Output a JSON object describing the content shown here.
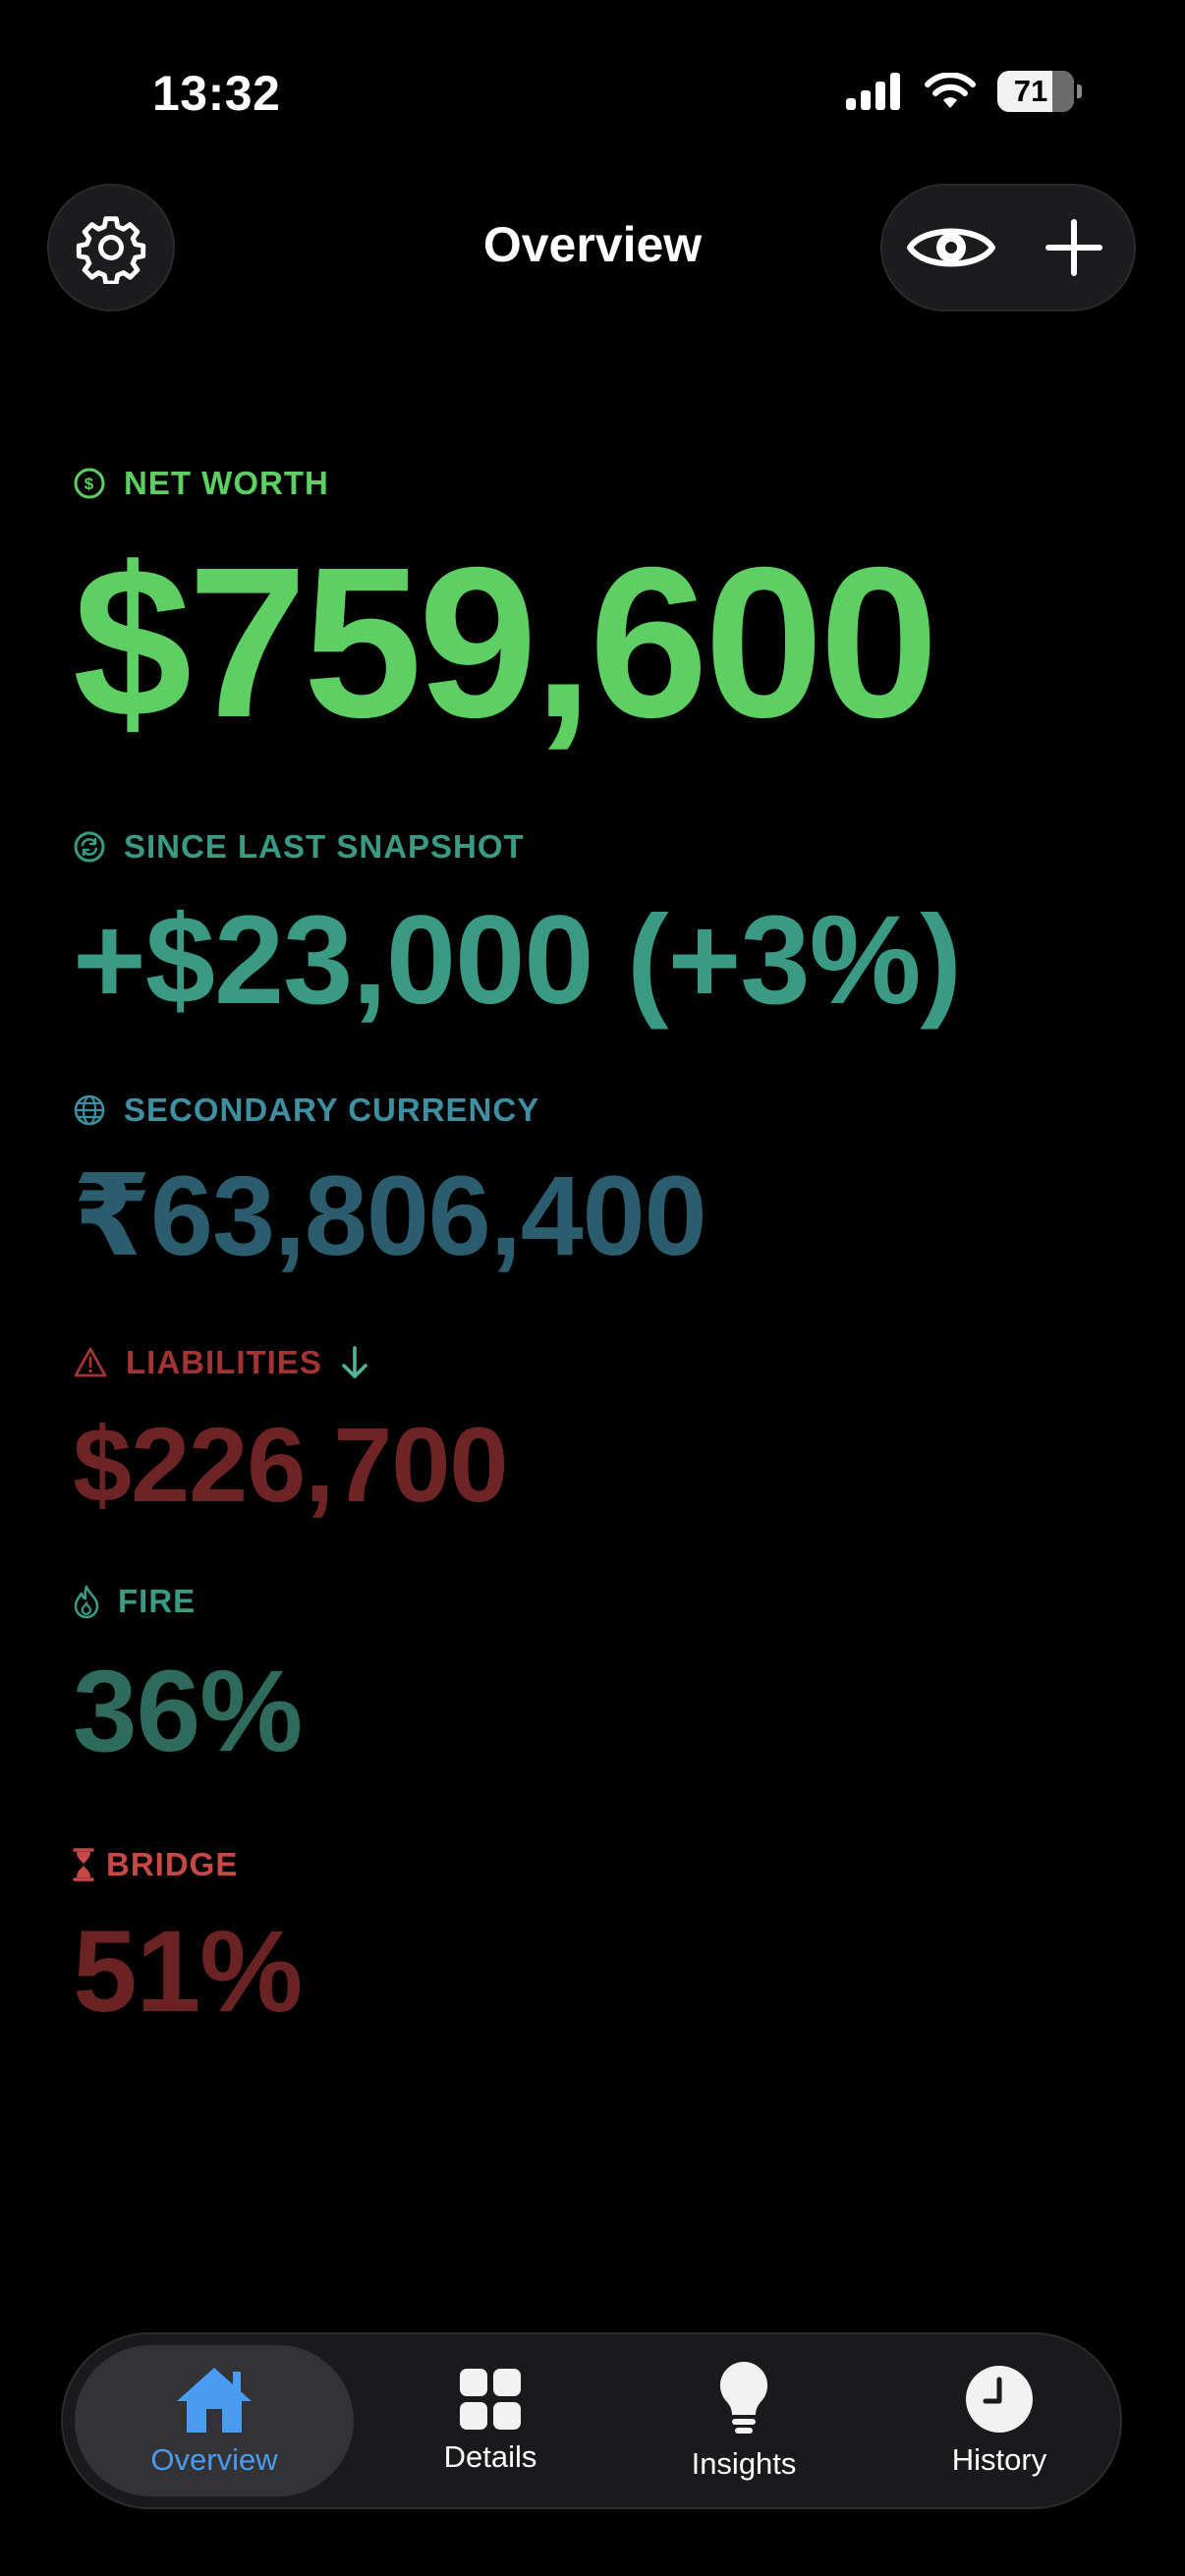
{
  "status_bar": {
    "time": "13:32",
    "battery": "71",
    "icons": [
      "cellular-signal-icon",
      "wifi-icon",
      "battery-icon"
    ]
  },
  "header": {
    "title": "Overview",
    "left_icon": "gear-icon",
    "right_icons": [
      "eye-icon",
      "plus-icon"
    ]
  },
  "metrics": {
    "net_worth": {
      "label": "NET WORTH",
      "value": "$759,600",
      "icon": "dollar-circle-icon",
      "color": "#5ecf63"
    },
    "since_last": {
      "label": "SINCE LAST SNAPSHOT",
      "value": "+$23,000 (+3%)",
      "icon": "refresh-circle-icon",
      "color": "#3a9a84"
    },
    "secondary_currency": {
      "label": "SECONDARY CURRENCY",
      "value": "₹63,806,400",
      "icon": "globe-icon",
      "color": "#2c5d6e"
    },
    "liabilities": {
      "label": "LIABILITIES",
      "value": "$226,700",
      "icon": "warning-triangle-icon",
      "trend_icon": "arrow-down-icon",
      "color": "#6e2424"
    },
    "fire": {
      "label": "FIRE",
      "value": "36%",
      "icon": "flame-icon",
      "color": "#2e6b5c"
    },
    "bridge": {
      "label": "BRIDGE",
      "value": "51%",
      "icon": "hourglass-icon",
      "color": "#6b2222"
    }
  },
  "tabbar": {
    "tabs": [
      {
        "label": "Overview",
        "icon": "house-icon",
        "active": true
      },
      {
        "label": "Details",
        "icon": "grid-icon",
        "active": false
      },
      {
        "label": "Insights",
        "icon": "lightbulb-icon",
        "active": false
      },
      {
        "label": "History",
        "icon": "clock-icon",
        "active": false
      }
    ],
    "accent": "#4a9cf0"
  }
}
